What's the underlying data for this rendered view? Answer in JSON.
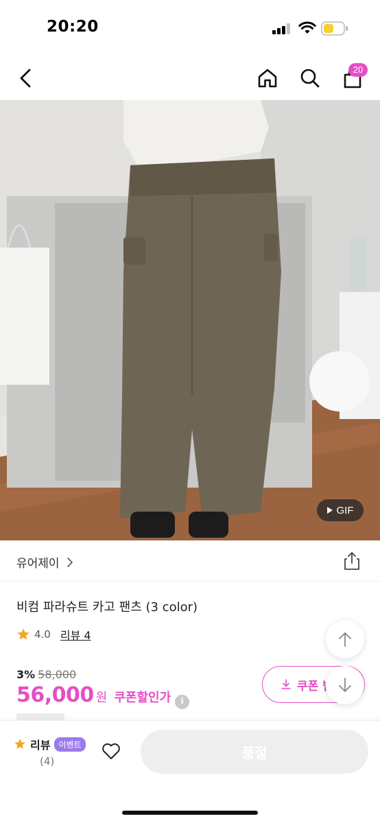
{
  "status_bar": {
    "time": "20:20"
  },
  "nav": {
    "back_icon": "chevron-left-icon",
    "home_icon": "home-icon",
    "search_icon": "search-icon",
    "cart_icon": "shopping-bag-icon",
    "cart_count": "20"
  },
  "gallery": {
    "gif_label": "GIF"
  },
  "seller": {
    "name": "유어제이",
    "share_icon": "share-icon"
  },
  "product": {
    "title": "비컴 파라슈트 카고 팬츠 (3 color)",
    "rating": "4.0",
    "review_link": "리뷰 4",
    "discount_rate": "3%",
    "original_price": "58,000",
    "price": "56,000",
    "price_unit": "원",
    "coupon_label": "쿠폰할인가",
    "coupon_button": "쿠폰 받"
  },
  "bottom_bar": {
    "review_label": "리뷰",
    "event_badge": "이벤트",
    "review_count": "(4)",
    "soldout_label": "품절"
  },
  "colors": {
    "accent": "#e64ec5",
    "event_badge": "#9b7bea",
    "star": "#f5a623"
  }
}
